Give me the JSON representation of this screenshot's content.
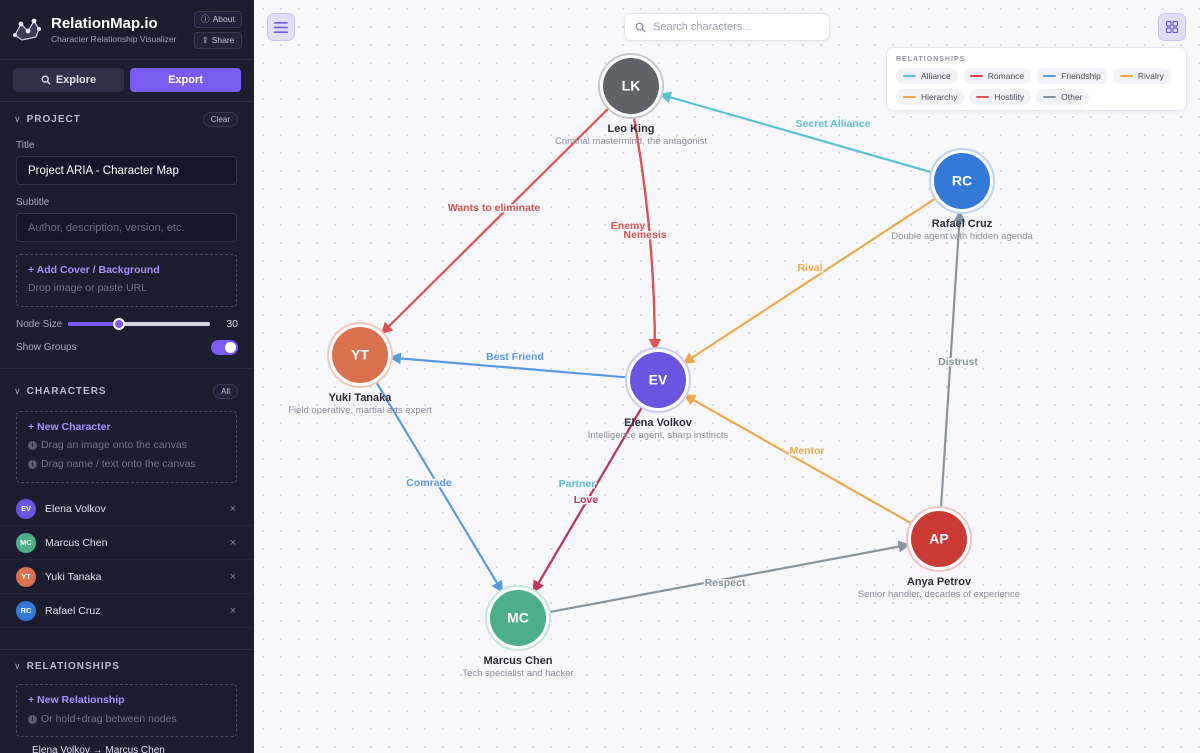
{
  "app": {
    "title": "RelationMap.io",
    "subtitle": "Character Relationship Visualizer",
    "about_label": "About",
    "share_label": "Share"
  },
  "modes": {
    "explore_label": "Explore",
    "export_label": "Export"
  },
  "project": {
    "section_label": "PROJECT",
    "clear_label": "Clear",
    "title_label": "Title",
    "title_value": "Project ARIA - Character Map",
    "subtitle_label": "Subtitle",
    "subtitle_placeholder": "Author, description, version, etc.",
    "cover_title": "+ Add Cover / Background",
    "cover_hint": "Drop image or paste URL",
    "node_size_label": "Node Size",
    "node_size_value": "30",
    "node_size_fraction": 0.36,
    "show_groups_label": "Show Groups",
    "show_groups_on": true
  },
  "characters": {
    "section_label": "CHARACTERS",
    "all_label": "All",
    "new_title": "+ New Character",
    "hint1": "Drag an image onto the canvas",
    "hint2": "Drag name / text onto the canvas",
    "items": [
      {
        "initials": "EV",
        "name": "Elena Volkov",
        "color": "#6a55e0"
      },
      {
        "initials": "MC",
        "name": "Marcus Chen",
        "color": "#4dae8c"
      },
      {
        "initials": "YT",
        "name": "Yuki Tanaka",
        "color": "#d9714f"
      },
      {
        "initials": "RC",
        "name": "Rafael Cruz",
        "color": "#3579d8"
      }
    ],
    "remove_glyph": "×"
  },
  "relationships": {
    "section_label": "RELATIONSHIPS",
    "new_title": "+ New Relationship",
    "hint": "Or hold+drag between nodes",
    "first_item": "Elena Volkov → Marcus Chen"
  },
  "canvas": {
    "search_placeholder": "Search characters...",
    "legend_title": "RELATIONSHIPS",
    "legend": [
      {
        "name": "Alliance",
        "color": "#5bc0d2"
      },
      {
        "name": "Romance",
        "color": "#d9455e"
      },
      {
        "name": "Friendship",
        "color": "#5a9be0"
      },
      {
        "name": "Rivalry",
        "color": "#eea94a"
      },
      {
        "name": "Hierarchy",
        "color": "#eea94a"
      },
      {
        "name": "Hostility",
        "color": "#d95353"
      },
      {
        "name": "Other",
        "color": "#8a939d"
      }
    ]
  },
  "graph": {
    "nodes": [
      {
        "id": "LK",
        "initials": "LK",
        "name": "Leo King",
        "desc": "Criminal mastermind, the antagonist",
        "color": "#5f6268",
        "ring": "#c7c8cc"
      },
      {
        "id": "RC",
        "initials": "RC",
        "name": "Rafael Cruz",
        "desc": "Double agent with hidden agenda",
        "color": "#3579d8",
        "ring": "#bfd2f1"
      },
      {
        "id": "YT",
        "initials": "YT",
        "name": "Yuki Tanaka",
        "desc": "Field operative, martial arts expert",
        "color": "#d9714f",
        "ring": "#f0c8ba"
      },
      {
        "id": "EV",
        "initials": "EV",
        "name": "Elena Volkov",
        "desc": "Intelligence agent, sharp instincts",
        "color": "#6a55e0",
        "ring": "#cfc8f4"
      },
      {
        "id": "AP",
        "initials": "AP",
        "name": "Anya Petrov",
        "desc": "Senior handler, decades of experience",
        "color": "#c93a36",
        "ring": "#eec3c1"
      },
      {
        "id": "MC",
        "initials": "MC",
        "name": "Marcus Chen",
        "desc": "Tech specialist and hacker",
        "color": "#4dae8c",
        "ring": "#c4e5d8"
      }
    ],
    "edges": [
      {
        "from": "RC",
        "to": "LK",
        "label": "Secret Alliance",
        "color": "#5bc0d2"
      },
      {
        "from": "LK",
        "to": "YT",
        "label": "Wants to eliminate",
        "color": "#d95353"
      },
      {
        "from": "LK",
        "to": "EV",
        "label": "Enemy",
        "color": "#d95353"
      },
      {
        "from": "LK",
        "to": "EV",
        "label": "Nemesis",
        "color": "#d95353"
      },
      {
        "from": "RC",
        "to": "EV",
        "label": "Rival",
        "color": "#eea94a"
      },
      {
        "from": "EV",
        "to": "YT",
        "label": "Best Friend",
        "color": "#5a9be0"
      },
      {
        "from": "AP",
        "to": "RC",
        "label": "Distrust",
        "color": "#8a939d"
      },
      {
        "from": "AP",
        "to": "EV",
        "label": "Mentor",
        "color": "#eea94a"
      },
      {
        "from": "YT",
        "to": "MC",
        "label": "Comrade",
        "color": "#5a9be0"
      },
      {
        "from": "EV",
        "to": "MC",
        "label": "Partner",
        "color": "#5bc0d2"
      },
      {
        "from": "EV",
        "to": "MC",
        "label": "Love",
        "color": "#c0355a"
      },
      {
        "from": "MC",
        "to": "AP",
        "label": "Respect",
        "color": "#8a939d"
      }
    ]
  }
}
